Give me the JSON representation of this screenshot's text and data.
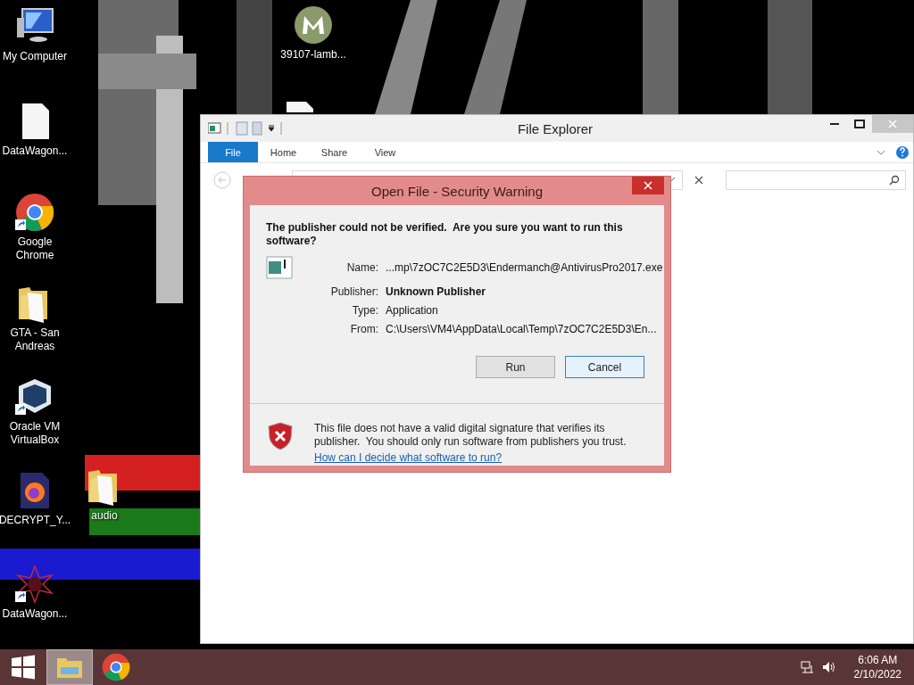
{
  "desktop": {
    "icons": [
      {
        "kind": "computer",
        "label": "My Computer",
        "shortcut": false
      },
      {
        "kind": "m-logo",
        "label": "39107-lamb...",
        "shortcut": false
      },
      {
        "kind": "file",
        "label": "DataWagon...",
        "shortcut": false
      },
      {
        "kind": "file"
      },
      {
        "kind": "chrome",
        "label": "Google Chrome",
        "shortcut": true
      },
      {
        "kind": "folder",
        "label": "GTA - San Andreas",
        "shortcut": false
      },
      {
        "kind": "virtualbox",
        "label": "Oracle VM VirtualBox",
        "shortcut": true
      },
      {
        "kind": "firefox-doc",
        "label": "DECRYPT_Y...",
        "shortcut": false
      },
      {
        "kind": "folder",
        "label": "audio",
        "shortcut": false
      },
      {
        "kind": "star",
        "label": "DataWagon...",
        "shortcut": true
      }
    ]
  },
  "explorer": {
    "title": "File Explorer",
    "ribbon_tabs": [
      {
        "label": "File",
        "selected": true
      },
      {
        "label": "Home",
        "selected": false
      },
      {
        "label": "Share",
        "selected": false
      },
      {
        "label": "View",
        "selected": false
      }
    ]
  },
  "dialog": {
    "title": "Open File - Security Warning",
    "question": "The publisher could not be verified.  Are you sure you want to run this software?",
    "details": [
      {
        "label": "Name:",
        "value": "...mp\\7zOC7C2E5D3\\Endermanch@AntivirusPro2017.exe",
        "kind": "plain"
      },
      {
        "label": "Publisher:",
        "value": "Unknown Publisher",
        "kind": "bold"
      },
      {
        "label": "Type:",
        "value": "Application",
        "kind": "plain"
      },
      {
        "label": "From:",
        "value": "C:\\Users\\VM4\\AppData\\Local\\Temp\\7zOC7C2E5D3\\En...",
        "kind": "plain"
      }
    ],
    "buttons": [
      {
        "label": "Run",
        "focused": false
      },
      {
        "label": "Cancel",
        "focused": true
      }
    ],
    "warning": "This file does not have a valid digital signature that verifies its publisher.  You should only run software from publishers you trust.",
    "link": "How can I decide what software to run?"
  },
  "taskbar": {
    "apps": [
      {
        "kind": "explorer",
        "active": true
      },
      {
        "kind": "chrome",
        "active": false
      }
    ],
    "time": "6:06 AM",
    "date": "2/10/2022"
  }
}
